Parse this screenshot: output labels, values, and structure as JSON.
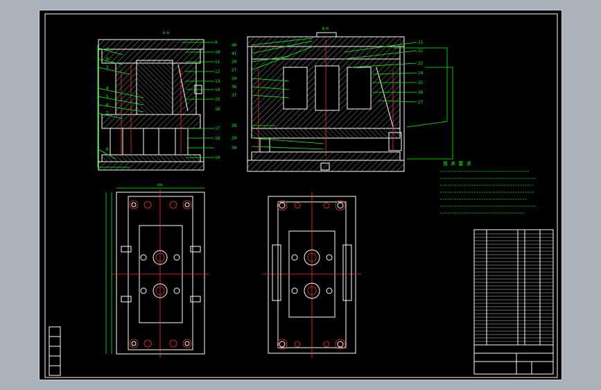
{
  "colors": {
    "background": "#a9b1ba",
    "sheet": "#000000",
    "outline": "#ffffff",
    "leader": "#00ff00",
    "section": "#ff3030",
    "hatch": "#9a9a9a"
  },
  "views": {
    "left_section": {
      "callouts_left": [
        "1",
        "8",
        "3",
        "4",
        "5",
        "6",
        "7",
        "6"
      ],
      "callouts_right": [
        "9",
        "10",
        "11",
        "12",
        "13",
        "14",
        "15",
        "16",
        "17",
        "18",
        "19"
      ]
    },
    "right_section": {
      "callouts_left": [
        "40",
        "41",
        "39",
        "27",
        "34",
        "36",
        "37",
        "28",
        "29",
        "30"
      ],
      "callouts_right": [
        "21",
        "22",
        "23",
        "24",
        "25",
        "26",
        "27"
      ]
    }
  },
  "notes": {
    "title": "技 术 要 求"
  }
}
